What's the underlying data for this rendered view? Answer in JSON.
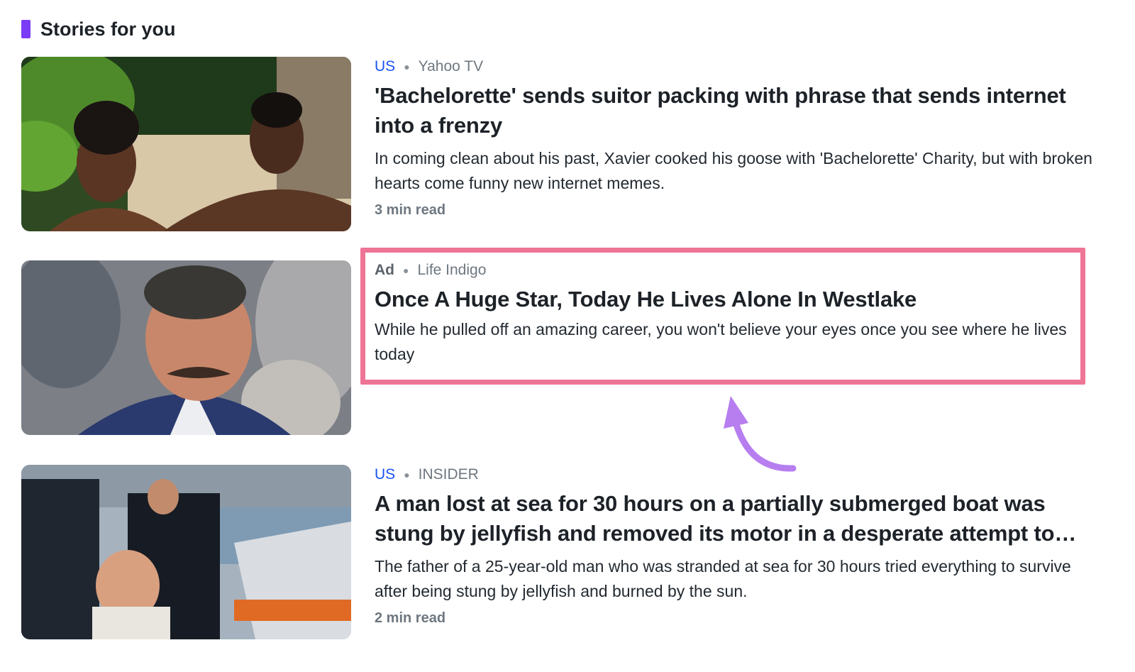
{
  "section": {
    "title": "Stories for you",
    "accent_color": "#7a3cf5"
  },
  "stories": [
    {
      "category": "US",
      "source": "Yahoo TV",
      "headline": "'Bachelorette' sends suitor packing with phrase that sends internet into a frenzy",
      "summary": "In coming clean about his past, Xavier cooked his goose with 'Bachelorette' Charity, but with broken hearts come funny new internet memes.",
      "read_time": "3 min read",
      "image": "photo-two-people-tropical"
    },
    {
      "category": "Ad",
      "source": "Life Indigo",
      "headline": "Once A Huge Star, Today He Lives Alone In Westlake",
      "summary": "While he pulled off an amazing career, you won't believe your eyes once you see where he lives today",
      "read_time": "",
      "image": "photo-man-mustache-suit"
    },
    {
      "category": "US",
      "source": "INSIDER",
      "headline": "A man lost at sea for 30 hours on a partially submerged boat was stung by jellyfish and removed its motor in a desperate attempt to…",
      "summary": "The father of a 25-year-old man who was stranded at sea for 30 hours tried everything to survive after being stung by jellyfish and burned by the sun.",
      "read_time": "2 min read",
      "image": "photo-rescue-crew-boat"
    }
  ],
  "annotation": {
    "highlight_color": "#ef7597",
    "arrow_color": "#b77ef0",
    "arrow_icon": "curved-arrow-up-icon"
  },
  "colors": {
    "category_link": "#1a56f0",
    "text": "#1d2228",
    "muted": "#6e7780"
  }
}
